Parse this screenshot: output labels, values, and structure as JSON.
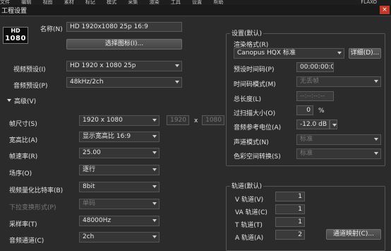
{
  "menubar": [
    "文件",
    "编辑",
    "视图",
    "素材",
    "标记",
    "模式",
    "采集",
    "渲染",
    "工具",
    "设置",
    "帮助"
  ],
  "menubar_right": "FLAXO",
  "window": {
    "title": "工程设置",
    "close": "×"
  },
  "logo": {
    "top": "HD",
    "bottom": "1080"
  },
  "name": {
    "label": "名称(N)",
    "value": "HD 1920x1080 25p 16:9"
  },
  "select_icon_button": "选择图标(I)...",
  "video_preset": {
    "label": "视频预设(I)",
    "value": "HD 1920 x 1080 25p"
  },
  "audio_preset": {
    "label": "音频预设(P)",
    "value": "48kHz/2ch"
  },
  "advanced": {
    "label": "高级(V)"
  },
  "frame_size": {
    "label": "帧尺寸(S)",
    "value": "1920 x 1080",
    "width": "1920",
    "x": "x",
    "height": "1080"
  },
  "aspect": {
    "label": "宽高比(A)",
    "value": "显示宽高比 16:9"
  },
  "frame_rate": {
    "label": "帧速率(R)",
    "value": "25.00"
  },
  "field_order": {
    "label": "场序(O)",
    "value": "逐行"
  },
  "bit_depth": {
    "label": "视频量化比特率(B)",
    "value": "8bit"
  },
  "pulldown": {
    "label": "下拉变换形式(P)",
    "value": "单码"
  },
  "sample_rate": {
    "label": "采样率(T)",
    "value": "48000Hz"
  },
  "audio_channels": {
    "label": "音频通道(C)",
    "value": "2ch"
  },
  "settings": {
    "group_title": "设置(默认)",
    "render_format": {
      "label": "渲染格式(R)",
      "value": "Canopus HQX 标准",
      "details": "详细(D)..."
    },
    "preset_timecode": {
      "label": "预设时间码(P)",
      "value": "00:00:00:00"
    },
    "timecode_mode": {
      "label": "时间码模式(M)",
      "value": "无丢帧"
    },
    "total_length": {
      "label": "总长度(L)",
      "value": "--:--:--:--"
    },
    "overscan": {
      "label": "过扫描大小(O)",
      "value": "0",
      "unit": "%"
    },
    "audio_ref_level": {
      "label": "音频参考电位(A)",
      "value": "-12.0 dB"
    },
    "channel_mode": {
      "label": "声道模式(N)",
      "value": "标准"
    },
    "color_space": {
      "label": "色彩空间转换(S)",
      "value": "标准"
    }
  },
  "tracks": {
    "group_title": "轨道(默认)",
    "v": {
      "label": "V 轨道(V)",
      "value": "1"
    },
    "va": {
      "label": "VA 轨道(C)",
      "value": "1"
    },
    "t": {
      "label": "T 轨道(T)",
      "value": "1"
    },
    "a": {
      "label": "A 轨道(A)",
      "value": "2"
    },
    "mapping_button": "通道映射(C)..."
  }
}
